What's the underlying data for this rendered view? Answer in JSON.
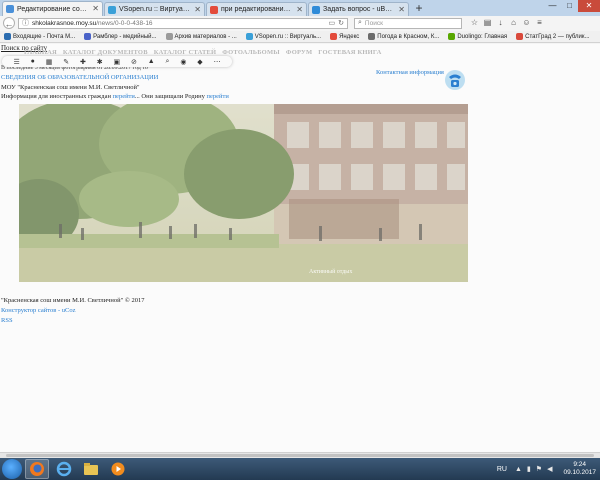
{
  "browser": {
    "tabs": [
      {
        "title": "Редактирование сообщения",
        "favicon_color": "#4a90d9",
        "active": true
      },
      {
        "title": "VSopen.ru :: Виртуальный ц",
        "favicon_color": "#3aa0d8",
        "active": false
      },
      {
        "title": "при редактировании новост",
        "favicon_color": "#e34b3b",
        "active": false
      },
      {
        "title": "Задать вопрос - uВопросы",
        "favicon_color": "#2f8bd8",
        "active": false
      }
    ],
    "new_tab_label": "+",
    "window_controls": {
      "minimize": "—",
      "maximize": "□",
      "close": "✕"
    },
    "url_domain": "shkolakrasnoe.moy.su",
    "url_path": "/news/0-0-0-438-16",
    "search_placeholder": "Поиск",
    "bookmarks": [
      {
        "label": "Входящие - Почта M...",
        "color": "#2b6cb0"
      },
      {
        "label": "Рамблер - медийный...",
        "color": "#4a63c8"
      },
      {
        "label": "Архив материалов - ...",
        "color": "#9a9a9a"
      },
      {
        "label": "VSopen.ru :: Виртуаль...",
        "color": "#3aa0d8"
      },
      {
        "label": "Яндекс",
        "color": "#e34b3b"
      },
      {
        "label": "Погода в Красном, К...",
        "color": "#6b6b6b"
      },
      {
        "label": "Duolingo: Главная",
        "color": "#58a700"
      },
      {
        "label": "СтатГрад 2 — публик...",
        "color": "#d9493b"
      }
    ]
  },
  "page": {
    "search_link": "Поиск по сайту",
    "menu": [
      "ГЛАВНАЯ",
      "КАТАЛОГ ДОКУМЕНТОВ",
      "КАТАЛОГ СТАТЕЙ",
      "ФОТОАЛЬБОМЫ",
      "ФОРУМ",
      "ГОСТЕВАЯ КНИГА"
    ],
    "intro_line": "В последние 3 месяцев фотографиям от 28.09.2017 год то",
    "contacts_link": "Контактная информация",
    "org_link": "СВЕДЕНИЯ ОБ ОБРАЗОВАТЕЛЬНОЙ ОРГАНИЗАЦИИ",
    "school_name": "МОУ \"Красненская сош имени М.И. Светличной\"",
    "info_text": "Информация для иностранных граждан",
    "info_link": "перейти",
    "info_sep": "... Они защищали Родину",
    "info_link2": "перейти",
    "photo_caption": "Активный отдых",
    "copyright": "\"Красненская сош имени М.И. Светличной\" © 2017",
    "constructor": "Конструктор сайтов - uCoz",
    "rss": "RSS"
  },
  "taskbar": {
    "lang": "RU",
    "time": "9:24",
    "date": "09.10.2017"
  }
}
